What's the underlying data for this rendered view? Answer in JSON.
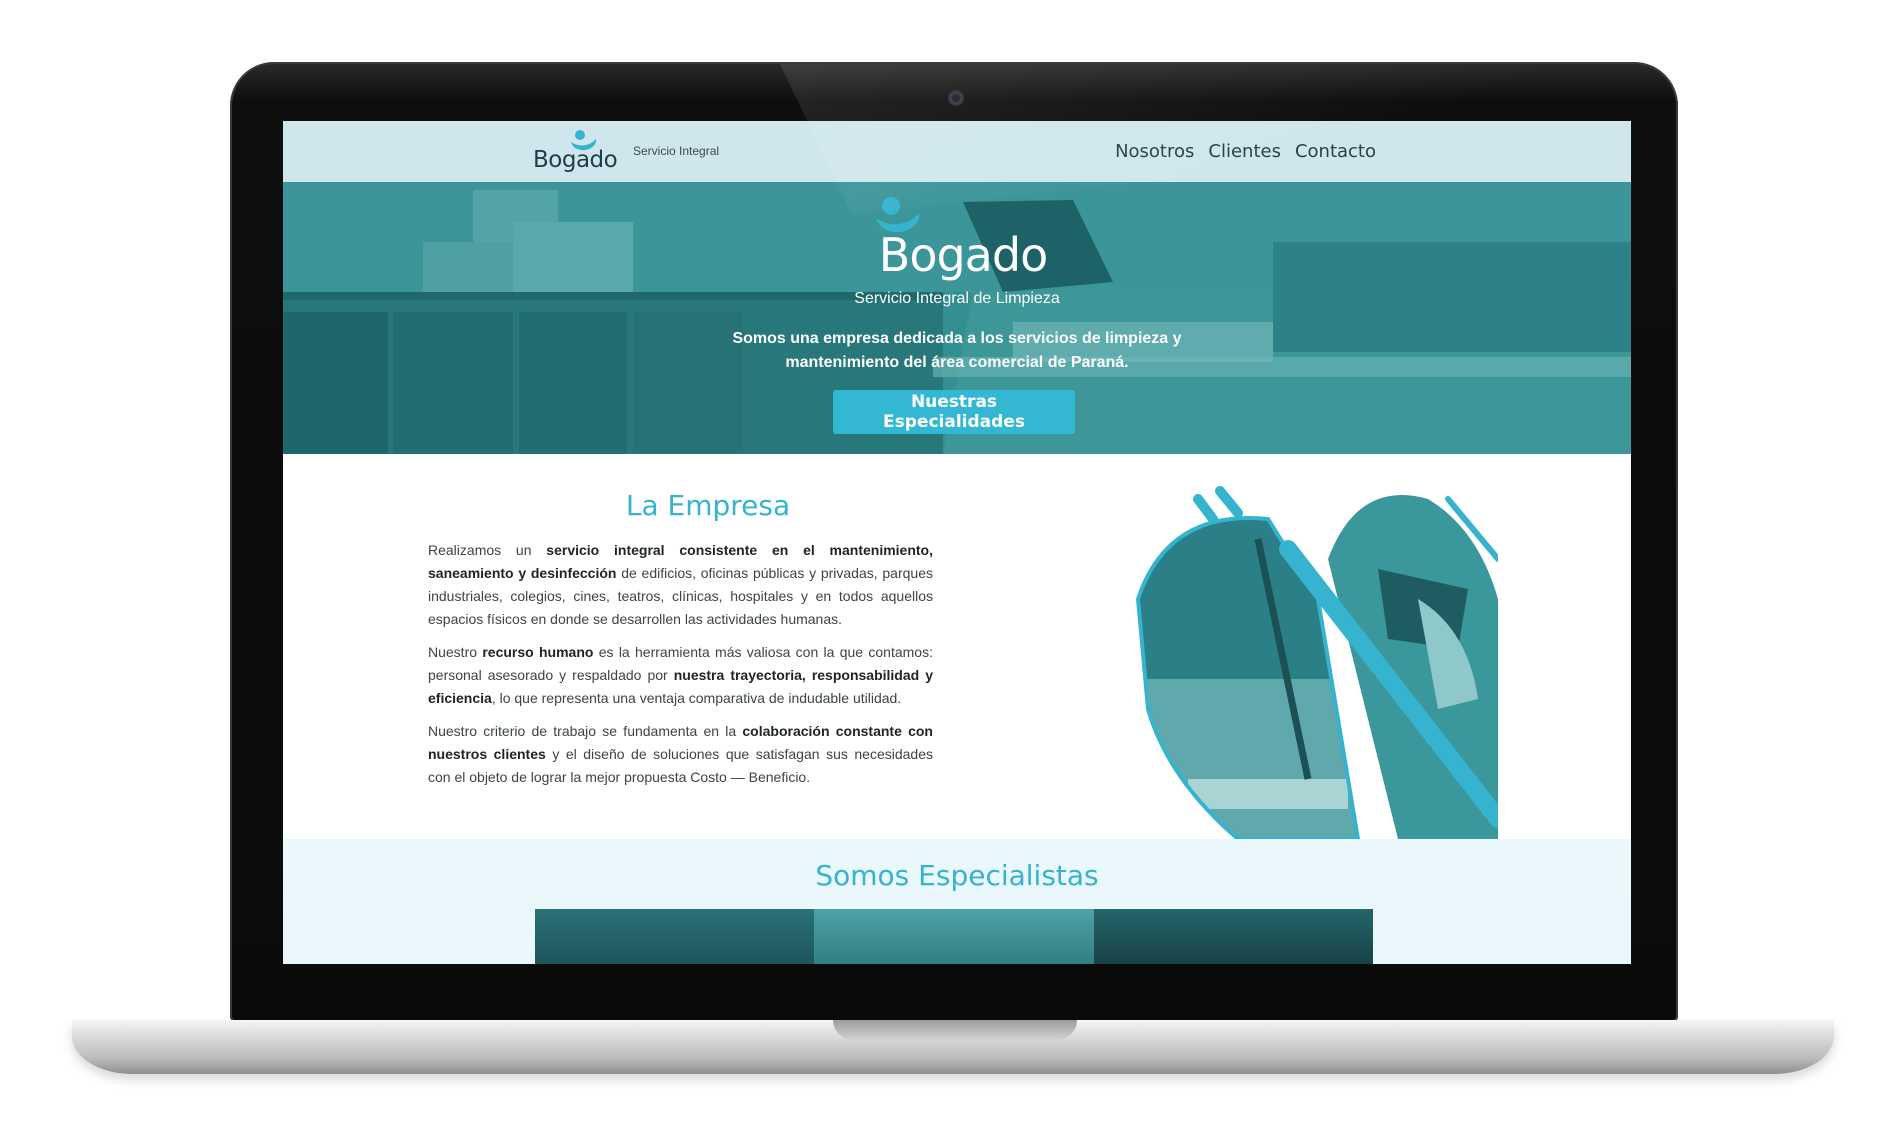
{
  "header": {
    "logo_text": "Bogado",
    "tagline": "Servicio Integral",
    "nav": [
      "Nosotros",
      "Clientes",
      "Contacto"
    ]
  },
  "hero": {
    "logo_text": "Bogado",
    "subtitle": "Servicio Integral de Limpieza",
    "text": "Somos una empresa dedicada a los servicios de limpieza y mantenimiento del área comercial de Paraná.",
    "button_label": "Nuestras Especialidades"
  },
  "empresa": {
    "title": "La Empresa",
    "paragraphs": [
      [
        {
          "t": "Realizamos un "
        },
        {
          "t": "servicio integral consistente en el mantenimiento, saneamiento y desinfección",
          "b": true
        },
        {
          "t": " de edificios, oficinas públicas y privadas, parques industriales, colegios, cines, teatros, clínicas, hospitales y en todos aquellos espacios físicos en donde se desarrollen las actividades humanas."
        }
      ],
      [
        {
          "t": "Nuestro "
        },
        {
          "t": "recurso humano",
          "b": true
        },
        {
          "t": " es la herramienta más valiosa con la que contamos: personal asesorado y respaldado por "
        },
        {
          "t": "nuestra trayectoria, responsabilidad y eficiencia",
          "b": true
        },
        {
          "t": ", lo que representa una ventaja comparativa de indudable utilidad."
        }
      ],
      [
        {
          "t": "Nuestro criterio de trabajo se fundamenta en la "
        },
        {
          "t": "colaboración constante con nuestros clientes",
          "b": true
        },
        {
          "t": " y el diseño de soluciones que satisfagan sus necesidades con el objeto de lograr la mejor propuesta Costo — Beneficio."
        }
      ]
    ]
  },
  "especialistas": {
    "title": "Somos Especialistas"
  },
  "colors": {
    "accent": "#35b3cf",
    "header_bg": "#cfe7ec",
    "hero_bg": "#3b8e90",
    "button_bg": "#33b8d3",
    "section_bg": "#eaf7fb"
  }
}
